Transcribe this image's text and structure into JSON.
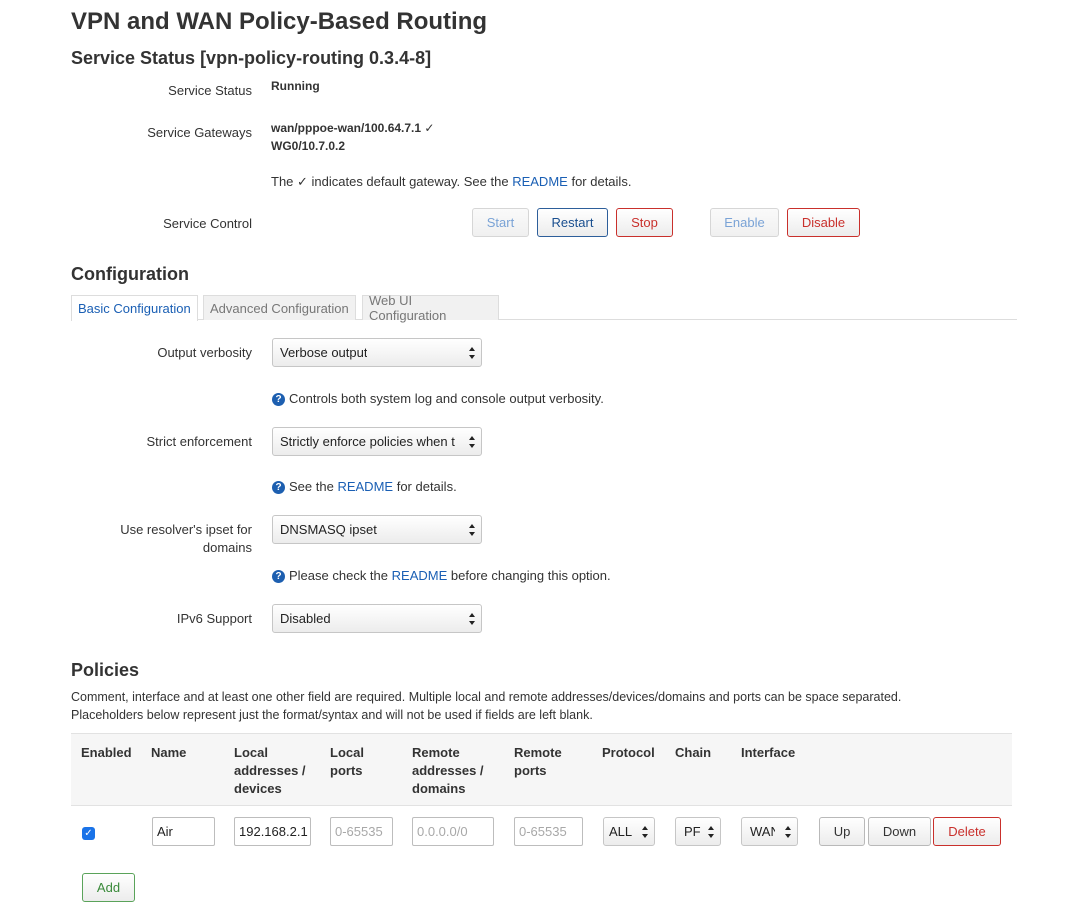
{
  "page": {
    "title": "VPN and WAN Policy-Based Routing"
  },
  "service": {
    "heading": "Service Status [vpn-policy-routing 0.3.4-8]",
    "status_label": "Service Status",
    "status_value": "Running",
    "gateways_label": "Service Gateways",
    "gateway_1": "wan/pppoe-wan/100.64.7.1 ✓",
    "gateway_2": "WG0/10.7.0.2",
    "note_prefix": "The ✓ indicates default gateway. See the",
    "note_link": "README",
    "note_suffix": "for details.",
    "control_label": "Service Control",
    "buttons": {
      "start": "Start",
      "restart": "Restart",
      "stop": "Stop",
      "enable": "Enable",
      "disable": "Disable"
    }
  },
  "configuration": {
    "heading": "Configuration",
    "tabs": [
      "Basic Configuration",
      "Advanced Configuration",
      "Web UI Configuration"
    ],
    "verbosity": {
      "label": "Output verbosity",
      "value": "Verbose output",
      "help": "Controls both system log and console output verbosity."
    },
    "strict": {
      "label": "Strict enforcement",
      "value": "Strictly enforce policies when t",
      "help_prefix": "See the",
      "help_link": "README",
      "help_suffix": "for details."
    },
    "resolver": {
      "label_line1": "Use resolver's ipset for",
      "label_line2": "domains",
      "value": "DNSMASQ ipset",
      "help_prefix": "Please check the",
      "help_link": "README",
      "help_suffix": "before changing this option."
    },
    "ipv6": {
      "label": "IPv6 Support",
      "value": "Disabled"
    }
  },
  "policies": {
    "heading": "Policies",
    "desc_line1": "Comment, interface and at least one other field are required. Multiple local and remote addresses/devices/domains and ports can be space separated.",
    "desc_line2": "Placeholders below represent just the format/syntax and will not be used if fields are left blank.",
    "columns": {
      "enabled": "Enabled",
      "name": "Name",
      "local_addr_1": "Local",
      "local_addr_2": "addresses /",
      "local_addr_3": "devices",
      "local_ports_1": "Local",
      "local_ports_2": "ports",
      "remote_addr_1": "Remote",
      "remote_addr_2": "addresses /",
      "remote_addr_3": "domains",
      "remote_ports_1": "Remote",
      "remote_ports_2": "ports",
      "protocol": "Protocol",
      "chain": "Chain",
      "interface": "Interface"
    },
    "row": {
      "enabled": true,
      "name": "Air",
      "local_addresses": "192.168.2.1",
      "local_ports_placeholder": "0-65535",
      "remote_addresses_placeholder": "0.0.0.0/0",
      "remote_ports_placeholder": "0-65535",
      "protocol": "ALL",
      "chain": "PF",
      "interface": "WAN",
      "up": "Up",
      "down": "Down",
      "delete": "Delete"
    },
    "add_button": "Add"
  }
}
